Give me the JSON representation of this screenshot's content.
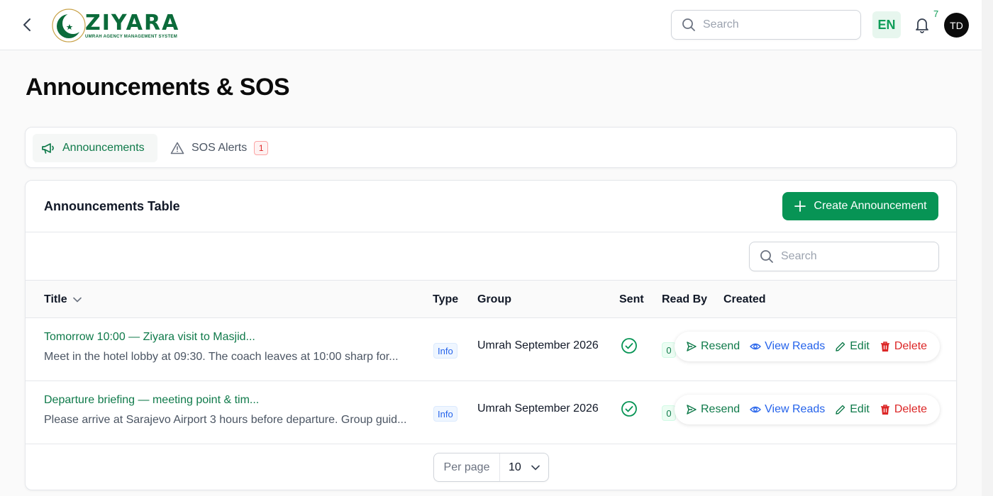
{
  "header": {
    "logo_name": "ZIYARA",
    "logo_tagline": "UMRAH AGENCY MANAGEMENT SYSTEM",
    "search_placeholder": "Search",
    "language": "EN",
    "notification_count": "7",
    "avatar_initials": "TD"
  },
  "page": {
    "title": "Announcements & SOS"
  },
  "tabs": [
    {
      "label": "Announcements",
      "icon": "megaphone-icon",
      "active": true
    },
    {
      "label": "SOS Alerts",
      "icon": "warning-triangle-icon",
      "badge": "1"
    }
  ],
  "table_card": {
    "title": "Announcements Table",
    "create_label": "Create Announcement",
    "search_placeholder": "Search",
    "columns": [
      "Title",
      "Type",
      "Group",
      "Sent",
      "Read By",
      "Created"
    ],
    "rows": [
      {
        "title": "Tomorrow 10:00 — Ziyara visit to Masjid...",
        "description": "Meet in the hotel lobby at 09:30. The coach leaves at 10:00 sharp for...",
        "type": "Info",
        "group": "Umrah September 2026",
        "sent": true,
        "read_by": "0"
      },
      {
        "title": "Departure briefing — meeting point & tim...",
        "description": "Please arrive at Sarajevo Airport 3 hours before departure. Group guid...",
        "type": "Info",
        "group": "Umrah September 2026",
        "sent": true,
        "read_by": "0"
      }
    ],
    "actions": {
      "resend": "Resend",
      "view_reads": "View Reads",
      "edit": "Edit",
      "delete": "Delete"
    },
    "pagination": {
      "per_page_label": "Per page",
      "per_page_value": "10"
    }
  },
  "colors": {
    "brand_green": "#079455",
    "link_green": "#0f7a4a",
    "info_blue": "#2563eb",
    "danger_red": "#dc2626"
  }
}
